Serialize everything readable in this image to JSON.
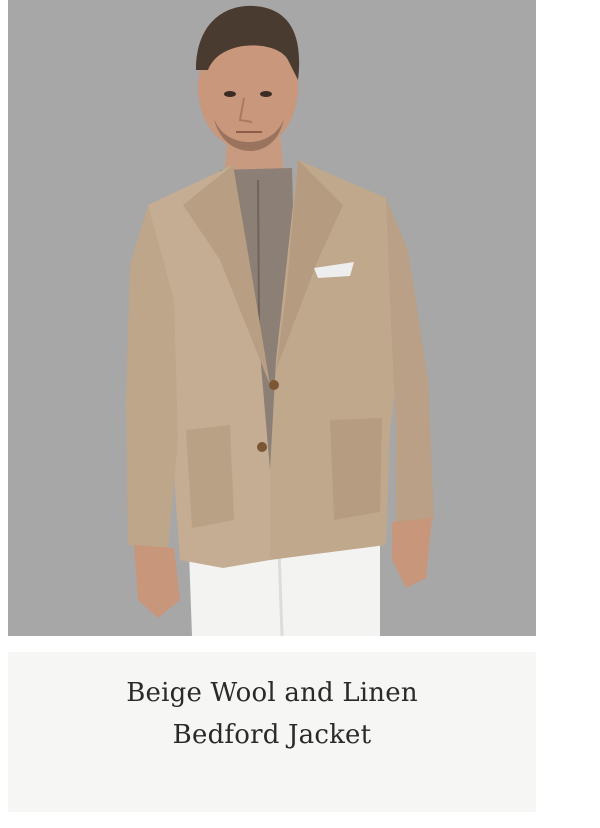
{
  "product": {
    "title_line1": "Beige Wool and Linen",
    "title_line2": "Bedford Jacket",
    "image_alt": "Model wearing beige wool and linen jacket with white trousers"
  },
  "colors": {
    "image_background": "#a8a8a8",
    "caption_background": "#f6f6f4",
    "jacket": "#c4ad93",
    "trousers": "#f4f4f2",
    "shirt": "#8c7f76",
    "text": "#2a2a2a"
  }
}
